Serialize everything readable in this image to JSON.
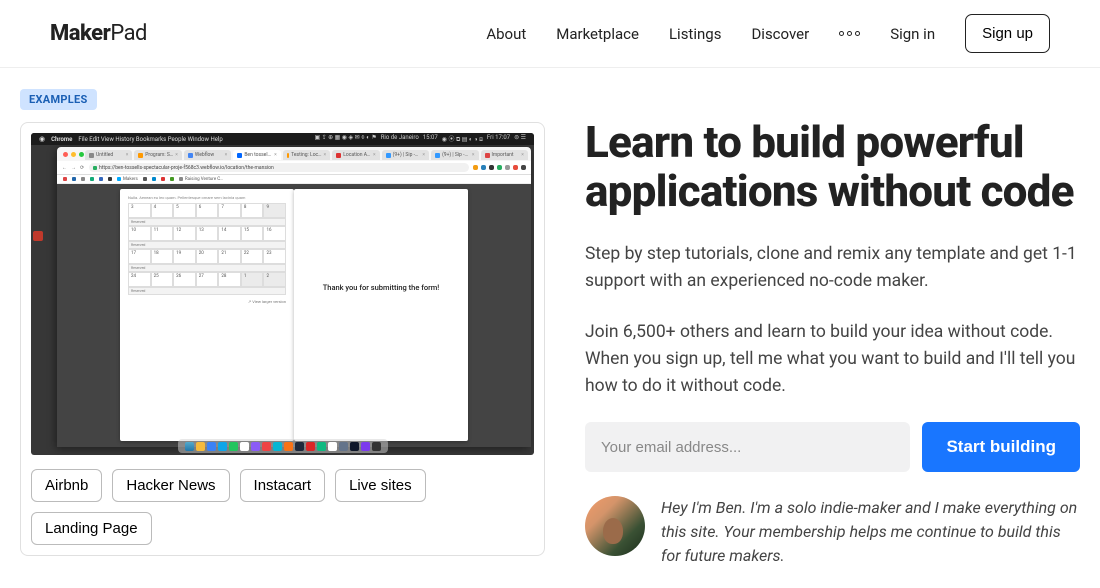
{
  "nav": {
    "logo_bold": "Maker",
    "logo_light": "Pad",
    "links": {
      "about": "About",
      "marketplace": "Marketplace",
      "listings": "Listings",
      "discover": "Discover"
    },
    "signin": "Sign in",
    "signup": "Sign up"
  },
  "examples": {
    "badge": "EXAMPLES",
    "chips": [
      "Airbnb",
      "Hacker News",
      "Instacart",
      "Live sites",
      "Landing Page"
    ]
  },
  "screencap": {
    "menubar": {
      "app": "Chrome",
      "items": [
        "File",
        "Edit",
        "View",
        "History",
        "Bookmarks",
        "People",
        "Window",
        "Help"
      ],
      "location": "Rio de Janeiro",
      "time": "15:07",
      "day": "Fri 17:07"
    },
    "tabs": [
      "Untitled",
      "Program: S…",
      "Webflow",
      "Ben tossel…",
      "Testing: Loc…",
      "Location A…",
      "(9+) | Sip -…",
      "(9+) | Sip -…",
      "Important"
    ],
    "url": "https://ben-tossells-spectacular-proje-f568c3.webflow.io/location/the-mansion",
    "bookmarks": [
      "Makers",
      "Raising Venture C…"
    ],
    "panel1": {
      "header": "Nulla. Aenean eu leo quam. Pellentesque ornare sem lacinia quam",
      "cells": [
        [
          "3",
          "4",
          "5",
          "6",
          "7",
          "8",
          "9"
        ],
        [
          "Reserved",
          "",
          "",
          "",
          "",
          "",
          "Reserved"
        ],
        [
          "10",
          "11",
          "12",
          "13",
          "14",
          "15",
          "16"
        ],
        [
          "Reserved",
          "",
          "",
          "",
          "",
          "",
          ""
        ],
        [
          "17",
          "18",
          "19",
          "20",
          "21",
          "22",
          "23"
        ],
        [
          "Reserved",
          "",
          "",
          "",
          "",
          "",
          ""
        ],
        [
          "24",
          "25",
          "26",
          "27",
          "28",
          "1",
          "2"
        ],
        [
          "Reserved",
          "",
          "",
          "",
          "",
          "",
          ""
        ]
      ],
      "viewlink": "↗ View larger version"
    },
    "panel2_msg": "Thank you for submitting the form!"
  },
  "hero": {
    "headline": "Learn to build powerful applications without code",
    "para1": "Step by step tutorials, clone and remix any template and get 1-1 support with an experienced no-code maker.",
    "para2": "Join 6,500+ others and learn to build your idea without code. When you sign up, tell me what you want to build and I'll tell you how to do it without code.",
    "email_placeholder": "Your email address...",
    "cta": "Start building",
    "bio": "Hey I'm Ben. I'm a solo indie-maker and I make everything on this site. Your membership helps me continue to build this for future makers."
  }
}
